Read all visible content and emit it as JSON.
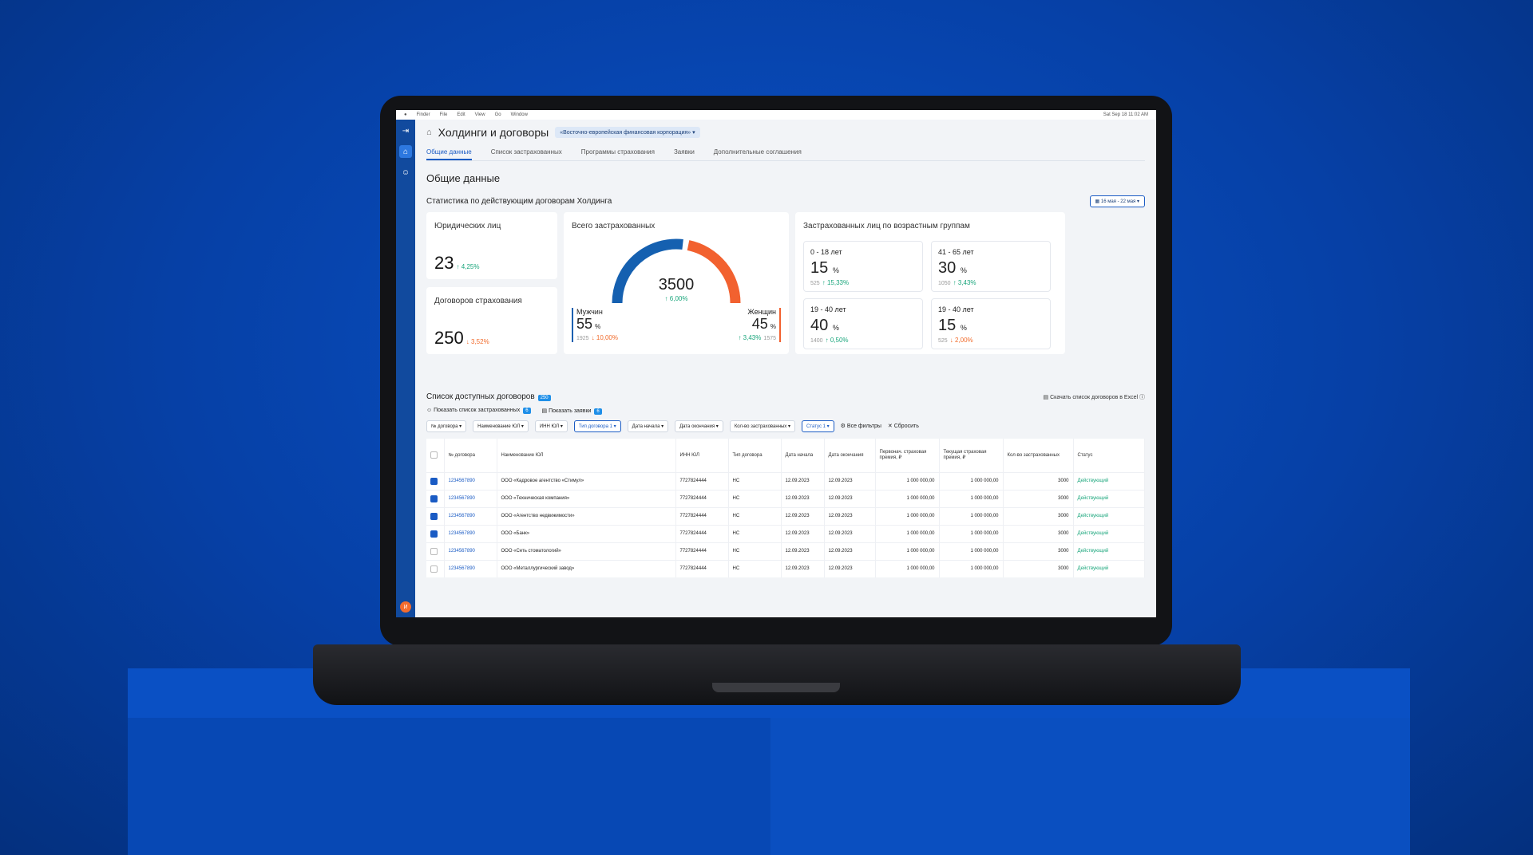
{
  "menubar": {
    "app": "Finder",
    "items": [
      "File",
      "Edit",
      "View",
      "Go",
      "Window"
    ],
    "clock": "Sat Sep 18  11:02 AM"
  },
  "sidebar": {
    "avatar_initial": "И"
  },
  "header": {
    "title": "Холдинги и договоры",
    "company": "«Восточно-европейская финансовая корпорация»"
  },
  "tabs": [
    "Общие данные",
    "Список застрахованных",
    "Программы страхования",
    "Заявки",
    "Дополнительные соглашения"
  ],
  "section_title": "Общие данные",
  "stats": {
    "subtitle": "Статистика по действующим договорам Холдинга",
    "date_range": "16 мая - 22 мая",
    "legal": {
      "label": "Юридических лиц",
      "value": "23",
      "change": "↑ 4,25%"
    },
    "contracts": {
      "label": "Договоров страхования",
      "value": "250",
      "change": "↓ 3,52%"
    },
    "insured": {
      "label": "Всего застрахованных",
      "total": "3500",
      "total_change": "↑ 6,00%",
      "men": {
        "label": "Мужчин",
        "pct": "55",
        "unit": "%",
        "count": "1925",
        "change": "↓ 10,00%",
        "share": 0.55
      },
      "women": {
        "label": "Женщин",
        "pct": "45",
        "unit": "%",
        "count": "1575",
        "change": "↑ 3,43%",
        "share": 0.45
      }
    },
    "age": {
      "label": "Застрахованных лиц по возрастным группам",
      "groups": [
        {
          "range": "0 - 18 лет",
          "pct": "15",
          "count": "525",
          "change": "↑ 15,33%",
          "dir": "up"
        },
        {
          "range": "41 - 65 лет",
          "pct": "30",
          "count": "1050",
          "change": "↑ 3,43%",
          "dir": "up"
        },
        {
          "range": "19 - 40 лет",
          "pct": "40",
          "count": "1400",
          "change": "↑ 0,50%",
          "dir": "up"
        },
        {
          "range": "19 - 40 лет",
          "pct": "15",
          "count": "525",
          "change": "↓ 2,00%",
          "dir": "down"
        }
      ]
    }
  },
  "list": {
    "title": "Список доступных договоров",
    "count": "250",
    "download": "Скачать список  договоров в Excel",
    "show_insured": "Показать список застрахованных",
    "show_insured_count": "6",
    "show_requests": "Показать заявки",
    "show_requests_count": "6",
    "filters": [
      "№ договора",
      "Наименование ЮЛ",
      "ИНН ЮЛ",
      "Тип договора",
      "Дата начала",
      "Дата окончания",
      "Кол-во застрахованных",
      "Статус"
    ],
    "all_filters": "Все фильтры",
    "reset": "Сбросить",
    "columns": [
      "№ договора",
      "Наименование ЮЛ",
      "ИНН ЮЛ",
      "Тип договора",
      "Дата начала",
      "Дата окончания",
      "Первонач. страховая премия, ₽",
      "Текущая страховая премия, ₽",
      "Кол-во застрахованных",
      "Статус"
    ],
    "rows": [
      {
        "checked": true,
        "num": "1234567890",
        "name": "ООО «Кадровое агентство «Стимул»",
        "inn": "7727824444",
        "type": "НС",
        "start": "12.09.2023",
        "end": "12.09.2023",
        "p1": "1 000 000,00",
        "p2": "1 000 000,00",
        "qty": "3000",
        "status": "Действующий"
      },
      {
        "checked": true,
        "num": "1234567890",
        "name": "ООО «Техническая компания»",
        "inn": "7727824444",
        "type": "НС",
        "start": "12.09.2023",
        "end": "12.09.2023",
        "p1": "1 000 000,00",
        "p2": "1 000 000,00",
        "qty": "3000",
        "status": "Действующий"
      },
      {
        "checked": true,
        "num": "1234567890",
        "name": "ООО «Агентство недвижимости»",
        "inn": "7727824444",
        "type": "НС",
        "start": "12.09.2023",
        "end": "12.09.2023",
        "p1": "1 000 000,00",
        "p2": "1 000 000,00",
        "qty": "3000",
        "status": "Действующий"
      },
      {
        "checked": true,
        "num": "1234567890",
        "name": "ООО «Банк»",
        "inn": "7727824444",
        "type": "НС",
        "start": "12.09.2023",
        "end": "12.09.2023",
        "p1": "1 000 000,00",
        "p2": "1 000 000,00",
        "qty": "3000",
        "status": "Действующий"
      },
      {
        "checked": false,
        "num": "1234567890",
        "name": "ООО «Сеть стоматологий»",
        "inn": "7727824444",
        "type": "НС",
        "start": "12.09.2023",
        "end": "12.09.2023",
        "p1": "1 000 000,00",
        "p2": "1 000 000,00",
        "qty": "3000",
        "status": "Действующий"
      },
      {
        "checked": false,
        "num": "1234567890",
        "name": "ООО «Металлургический завод»",
        "inn": "7727824444",
        "type": "НС",
        "start": "12.09.2023",
        "end": "12.09.2023",
        "p1": "1 000 000,00",
        "p2": "1 000 000,00",
        "qty": "3000",
        "status": "Действующий"
      }
    ]
  },
  "colors": {
    "primary": "#1a5bc4",
    "men": "#1560b0",
    "women": "#f2612f",
    "positive": "#1aa67c",
    "negative": "#f16a2a"
  }
}
